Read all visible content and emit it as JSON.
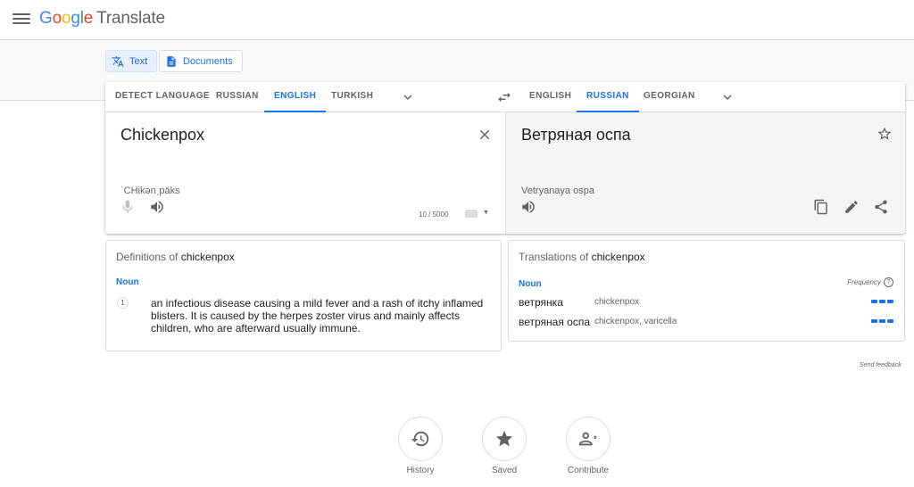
{
  "app": {
    "logo_letters": [
      "G",
      "o",
      "o",
      "g",
      "l",
      "e"
    ],
    "product": "Translate"
  },
  "modes": {
    "text_label": "Text",
    "documents_label": "Documents"
  },
  "source_langs": [
    "DETECT LANGUAGE",
    "RUSSIAN",
    "ENGLISH",
    "TURKISH"
  ],
  "source_selected": "ENGLISH",
  "target_langs": [
    "ENGLISH",
    "RUSSIAN",
    "GEORGIAN"
  ],
  "target_selected": "RUSSIAN",
  "source": {
    "text": "Chickenpox",
    "transliteration": "ˈCHikənˌpäks",
    "counter": "10 / 5000"
  },
  "target": {
    "text": "Ветряная оспа",
    "transliteration": "Vetryanaya ospa"
  },
  "definitions": {
    "title_prefix": "Definitions of ",
    "title_word": "chickenpox",
    "part_of_speech": "Noun",
    "items": [
      {
        "number": "1",
        "text": "an infectious disease causing a mild fever and a rash of itchy inflamed blisters. It is caused by the herpes zoster virus and mainly affects children, who are afterward usually immune."
      }
    ]
  },
  "translations": {
    "title_prefix": "Translations of ",
    "title_word": "chickenpox",
    "part_of_speech": "Noun",
    "frequency_label": "Frequency",
    "rows": [
      {
        "word": "ветрянка",
        "back": "chickenpox",
        "frequency": 3
      },
      {
        "word": "ветряная оспа",
        "back": "chickenpox, varicella",
        "frequency": 3
      }
    ]
  },
  "feedback": "Send feedback",
  "bottom": {
    "history": "History",
    "saved": "Saved",
    "contribute": "Contribute"
  },
  "colors": {
    "accent": "#1a73e8",
    "text_secondary": "#5f6368",
    "divider": "#dadce0",
    "target_bg": "#f5f5f5"
  }
}
